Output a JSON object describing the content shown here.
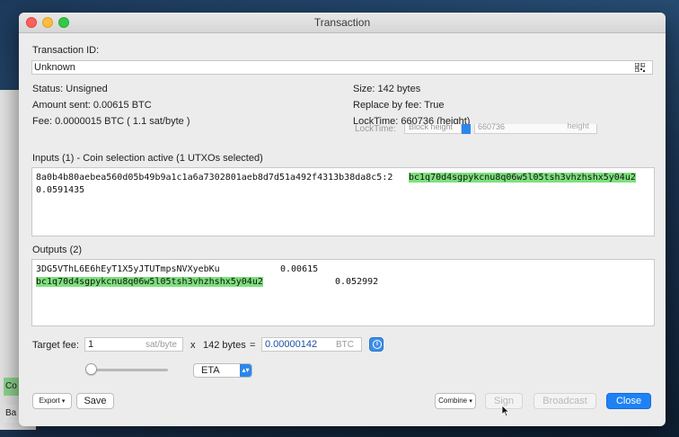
{
  "background": {
    "button_1": "Co",
    "button_2": "Ba"
  },
  "window": {
    "title": "Transaction"
  },
  "txid": {
    "label": "Transaction ID:",
    "value": "Unknown",
    "qr_icon": "qrcode-icon"
  },
  "status": {
    "status": "Status: Unsigned",
    "amount_sent": "Amount sent: 0.00615 BTC",
    "fee": "Fee: 0.0000015 BTC  ( 1.1 sat/byte )",
    "size": "Size: 142 bytes",
    "rbf": "Replace by fee: True",
    "locktime": "LockTime: 660736 (height)"
  },
  "ghost_locktime": {
    "label": "LockTime:",
    "mode": "Block height",
    "value": "660736",
    "unit": "height"
  },
  "inputs": {
    "label": "Inputs (1)  -  Coin selection active (1 UTXOs selected)",
    "rows": [
      {
        "outpoint": "8a0b4b80aebea560d05b49b9a1c1a6a7302801aeb8d7d51a492f4313b38da8c5:2",
        "address": "bc1q70d4sgpykcnu8q06w5l05tsh3vhzhshx5y04u2",
        "amount": "0.0591435"
      }
    ]
  },
  "outputs": {
    "label": "Outputs (2)",
    "rows": [
      {
        "address": "3DG5VThL6E6hEyT1X5yJTUTmpsNVXyebKu",
        "amount": "0.00615",
        "highlight": false
      },
      {
        "address": "bc1q70d4sgpykcnu8q06w5l05tsh3vhzhshx5y04u2",
        "amount": "0.052992",
        "highlight": true
      }
    ]
  },
  "fee_row": {
    "label": "Target fee:",
    "feerate_value": "1",
    "feerate_unit": "sat/byte",
    "times": "x",
    "bytes": "142 bytes",
    "equals": "=",
    "fee_value": "0.00000142",
    "fee_unit": "BTC",
    "info_icon": "info-icon"
  },
  "fee_slider": {
    "position": 0.0
  },
  "fee_method": {
    "selected": "ETA"
  },
  "buttons": {
    "export": "Export",
    "save": "Save",
    "combine": "Combine",
    "sign": "Sign",
    "broadcast": "Broadcast",
    "close": "Close"
  },
  "colors": {
    "highlight": "#7ee07e",
    "primary": "#1e82f5",
    "fee_value": "#1a4fa0"
  }
}
